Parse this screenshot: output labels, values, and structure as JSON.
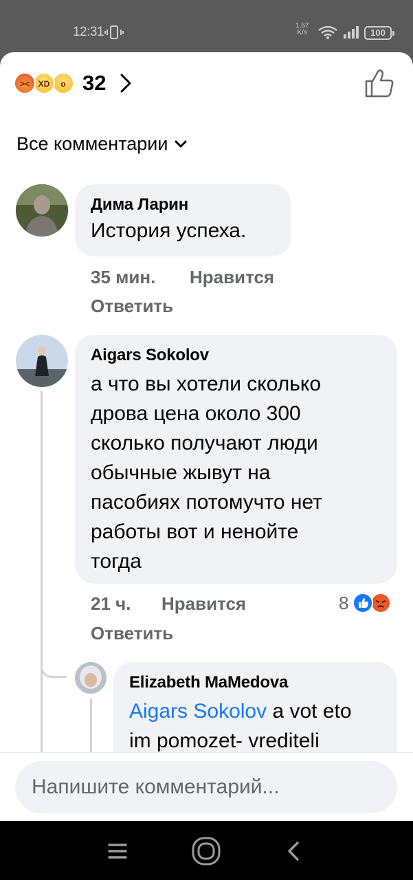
{
  "status_bar": {
    "time": "12:31",
    "net_speed_value": "1,67",
    "net_speed_unit": "K/s",
    "battery": "100"
  },
  "reactions": {
    "count": "32",
    "icons": [
      "angry-emoji",
      "haha-emoji",
      "wow-emoji"
    ]
  },
  "filter": {
    "label": "Все комментарии"
  },
  "comments": [
    {
      "author": "Дима Ларин",
      "text_lines": [
        "История успеха."
      ],
      "time": "35 мин.",
      "like_label": "Нравится",
      "reply_label": "Ответить"
    },
    {
      "author": "Aigars Sokolov",
      "text_lines": [
        "а что вы хотели сколько",
        "дрова цена около 300",
        "сколько получают люди",
        "обычные жывут на",
        "пасобиях потомучто нет",
        "работы вот и ненойте",
        "тогда"
      ],
      "time": "21 ч.",
      "like_label": "Нравится",
      "reply_label": "Ответить",
      "reaction_count": "8"
    }
  ],
  "reply": {
    "author": "Elizabeth MaMedova",
    "mention": "Aigars Sokolov",
    "text_line1_rest": " a vot eto",
    "text_line2": "im pomozet- vrediteli"
  },
  "composer": {
    "placeholder": "Напишите комментарий..."
  },
  "colors": {
    "link": "#1877f2",
    "bubble": "#f0f2f5",
    "meta": "#65676b"
  }
}
